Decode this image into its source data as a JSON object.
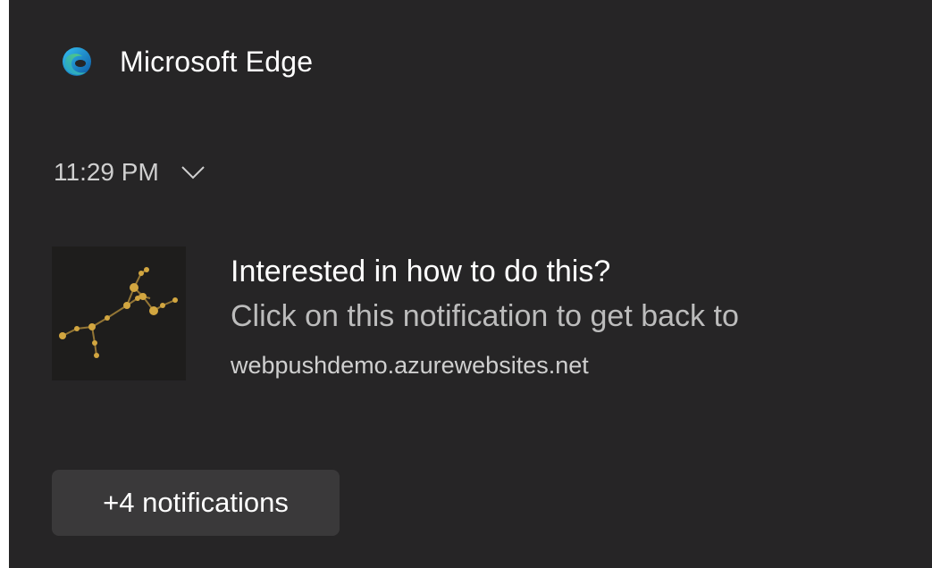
{
  "app": {
    "name": "Microsoft Edge",
    "icon": "edge-logo-icon"
  },
  "notification": {
    "time": "11:29 PM",
    "expand_icon": "chevron-down-icon",
    "title": "Interested in how to do this?",
    "body": "Click on this notification to get back to",
    "source": "webpushdemo.azurewebsites.net",
    "image": "constellation-thumbnail"
  },
  "more": {
    "label": "+4 notifications"
  },
  "colors": {
    "background": "#262526",
    "button": "#3a393a",
    "constellation": "#c9a13c"
  }
}
